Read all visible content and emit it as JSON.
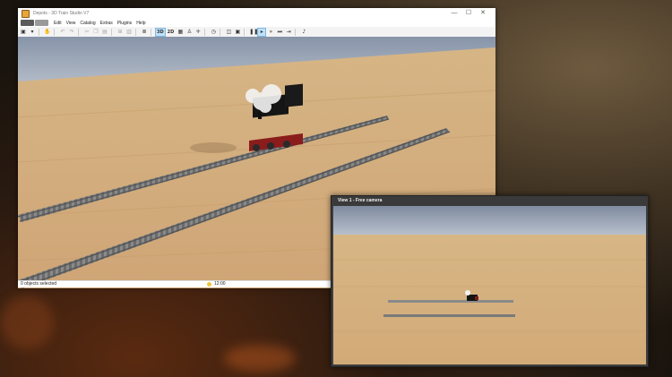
{
  "main_window": {
    "title": "Depots - 3D Train Studio V7",
    "controls": {
      "minimize": "—",
      "maximize": "☐",
      "close": "✕"
    },
    "menu": [
      "Edit",
      "View",
      "Catalog",
      "Extras",
      "Plugins",
      "Help"
    ],
    "toolbar": {
      "mode_3d": "3D",
      "mode_2d": "2D"
    },
    "status": {
      "selection": "0 objects selected",
      "time": "12:00"
    }
  },
  "camera_window": {
    "title": "View 1 - Free camera"
  },
  "colors": {
    "sky": "#8a9ab0",
    "table": "#d9b483",
    "accent": "#bfe0f7"
  }
}
